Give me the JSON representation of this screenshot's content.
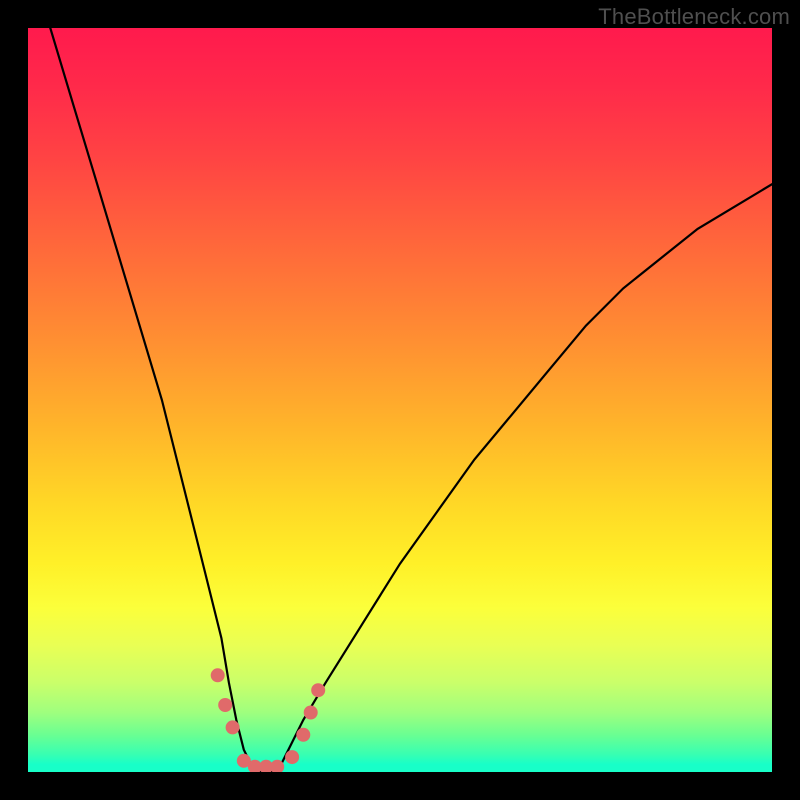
{
  "watermark": "TheBottleneck.com",
  "colors": {
    "frame": "#000000",
    "gradient_top": "#ff1a4d",
    "gradient_bottom": "#18ffc8",
    "curve": "#000000",
    "marker": "#e06a6a"
  },
  "chart_data": {
    "type": "line",
    "title": "",
    "xlabel": "",
    "ylabel": "",
    "xlim": [
      0,
      100
    ],
    "ylim": [
      0,
      100
    ],
    "series": [
      {
        "name": "bottleneck-curve",
        "x": [
          3,
          6,
          9,
          12,
          15,
          18,
          20,
          22,
          24,
          26,
          27,
          28,
          29,
          30,
          31,
          33,
          34,
          35,
          37,
          40,
          45,
          50,
          55,
          60,
          65,
          70,
          75,
          80,
          85,
          90,
          95,
          100
        ],
        "values": [
          100,
          90,
          80,
          70,
          60,
          50,
          42,
          34,
          26,
          18,
          12,
          7,
          3,
          1,
          0,
          0,
          1,
          3,
          7,
          12,
          20,
          28,
          35,
          42,
          48,
          54,
          60,
          65,
          69,
          73,
          76,
          79
        ]
      }
    ],
    "markers": [
      {
        "x": 25.5,
        "y": 13
      },
      {
        "x": 26.5,
        "y": 9
      },
      {
        "x": 27.5,
        "y": 6
      },
      {
        "x": 29,
        "y": 1.5
      },
      {
        "x": 30.5,
        "y": 0.7
      },
      {
        "x": 32,
        "y": 0.7
      },
      {
        "x": 33.5,
        "y": 0.7
      },
      {
        "x": 35.5,
        "y": 2
      },
      {
        "x": 37,
        "y": 5
      },
      {
        "x": 38,
        "y": 8
      },
      {
        "x": 39,
        "y": 11
      }
    ],
    "annotations": []
  }
}
